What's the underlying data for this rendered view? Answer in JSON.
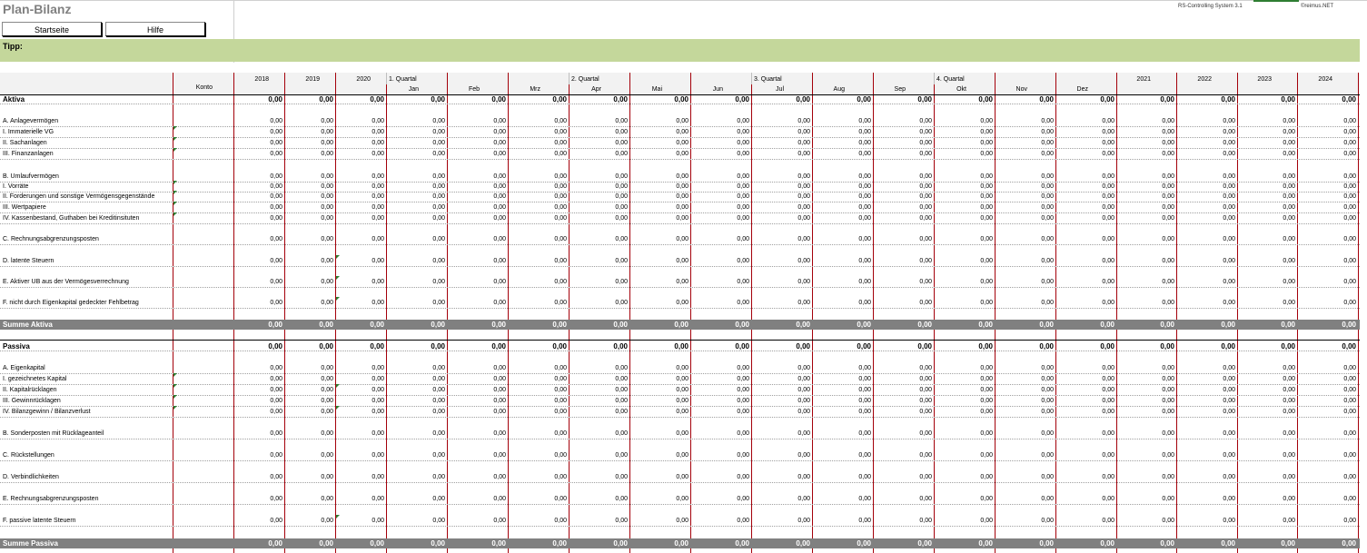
{
  "title": "Plan-Bilanz",
  "buttons": {
    "startseite": "Startseite",
    "hilfe": "Hilfe"
  },
  "brand": {
    "system": "RS-Controlling System 3.1",
    "vendor": "©reimus.NET"
  },
  "tipp_label": "Tipp:",
  "header": {
    "konto": "Konto",
    "years_before": [
      "2018",
      "2019",
      "2020"
    ],
    "quarters": [
      "1. Quartal",
      "2. Quartal",
      "3. Quartal",
      "4. Quartal"
    ],
    "months": [
      "Jan",
      "Feb",
      "Mrz",
      "Apr",
      "Mai",
      "Jun",
      "Jul",
      "Aug",
      "Sep",
      "Okt",
      "Nov",
      "Dez"
    ],
    "years_after": [
      "2021",
      "2022",
      "2023",
      "2024"
    ]
  },
  "zero": "0,00",
  "aktiva": {
    "heading": "Aktiva",
    "rows": [
      "A. Anlagevermögen",
      "I. Immaterielle VG",
      "II. Sachanlagen",
      "III. Finanzanlagen",
      "B. Umlaufvermögen",
      "I. Vorräte",
      "II. Forderungen und sonstige Vermögensgegenstände",
      "III. Wertpapiere",
      "IV. Kassenbestand, Guthaben bei Kreditinsituten",
      "C. Rechnungsabgrenzungsposten",
      "D. latente Steuern",
      "E. Aktiver UB aus der Vermögesverrechnung",
      "F. nicht durch Eigenkapital gedeckter Fehlbetrag"
    ],
    "sum": "Summe Aktiva"
  },
  "passiva": {
    "heading": "Passiva",
    "rows": [
      "A. Eigenkapital",
      "I. gezeichnetes Kapital",
      "II. Kapitalrücklagen",
      "III. Gewinnrücklagen",
      "IV. Bilanzgewinn / Bilanzverlust",
      "B. Sonderposten mit Rücklageanteil",
      "C. Rückstellungen",
      "D. Verbindlichkeiten",
      "E. Rechnungsabgrenzungsposten",
      "F. passive latente Steuern"
    ],
    "sum": "Summe Passiva"
  }
}
